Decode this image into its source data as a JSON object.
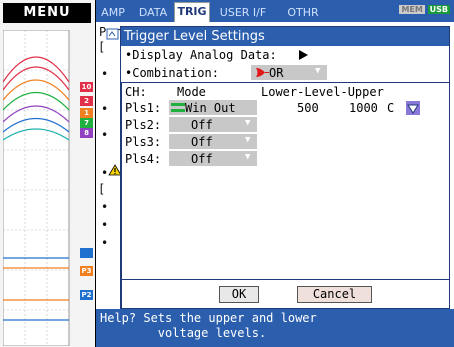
{
  "menu": {
    "label": "MENU"
  },
  "tabs": [
    {
      "label": "AMP",
      "active": false
    },
    {
      "label": "DATA",
      "active": false
    },
    {
      "label": "TRIG",
      "active": true
    },
    {
      "label": "USER I/F",
      "active": false
    },
    {
      "label": "OTHR",
      "active": false
    }
  ],
  "status": {
    "mem": "MEM",
    "usb": "USB"
  },
  "channels": [
    {
      "tag": "10",
      "color": "#e0304a"
    },
    {
      "tag": "2",
      "color": "#e0304a"
    },
    {
      "tag": "1",
      "color": "#f08020"
    },
    {
      "tag": "7",
      "color": "#20b040"
    },
    {
      "tag": "8",
      "color": "#9040c0"
    },
    {
      "tag": "P3",
      "color": "#f08020"
    },
    {
      "tag": "P2",
      "color": "#2070d0"
    }
  ],
  "background": {
    "title_fragment": "Per",
    "lines": [
      "[",
      "•",
      "•",
      "•",
      "•",
      "[",
      "•",
      "•",
      "•"
    ]
  },
  "dialog": {
    "title": "Trigger Level Settings",
    "display_analog_label": "•Display Analog Data:",
    "combination_label": "•Combination:",
    "combination_value": "OR",
    "header": {
      "ch": "CH:",
      "mode": "Mode",
      "levels": "Lower-Level-Upper"
    },
    "rows": [
      {
        "ch": "Pls1:",
        "mode": "Win Out",
        "lower": "500",
        "upper": "1000",
        "unit": "C"
      },
      {
        "ch": "Pls2:",
        "mode": "Off"
      },
      {
        "ch": "Pls3:",
        "mode": "Off"
      },
      {
        "ch": "Pls4:",
        "mode": "Off"
      }
    ],
    "ok_label": "OK",
    "cancel_label": "Cancel"
  },
  "help": {
    "text": "Help? Sets the upper and lower\n        voltage levels."
  },
  "colors": {
    "accent": "#2b5fae",
    "selector": "#7a5cc0",
    "combo_red": "#e01818"
  }
}
